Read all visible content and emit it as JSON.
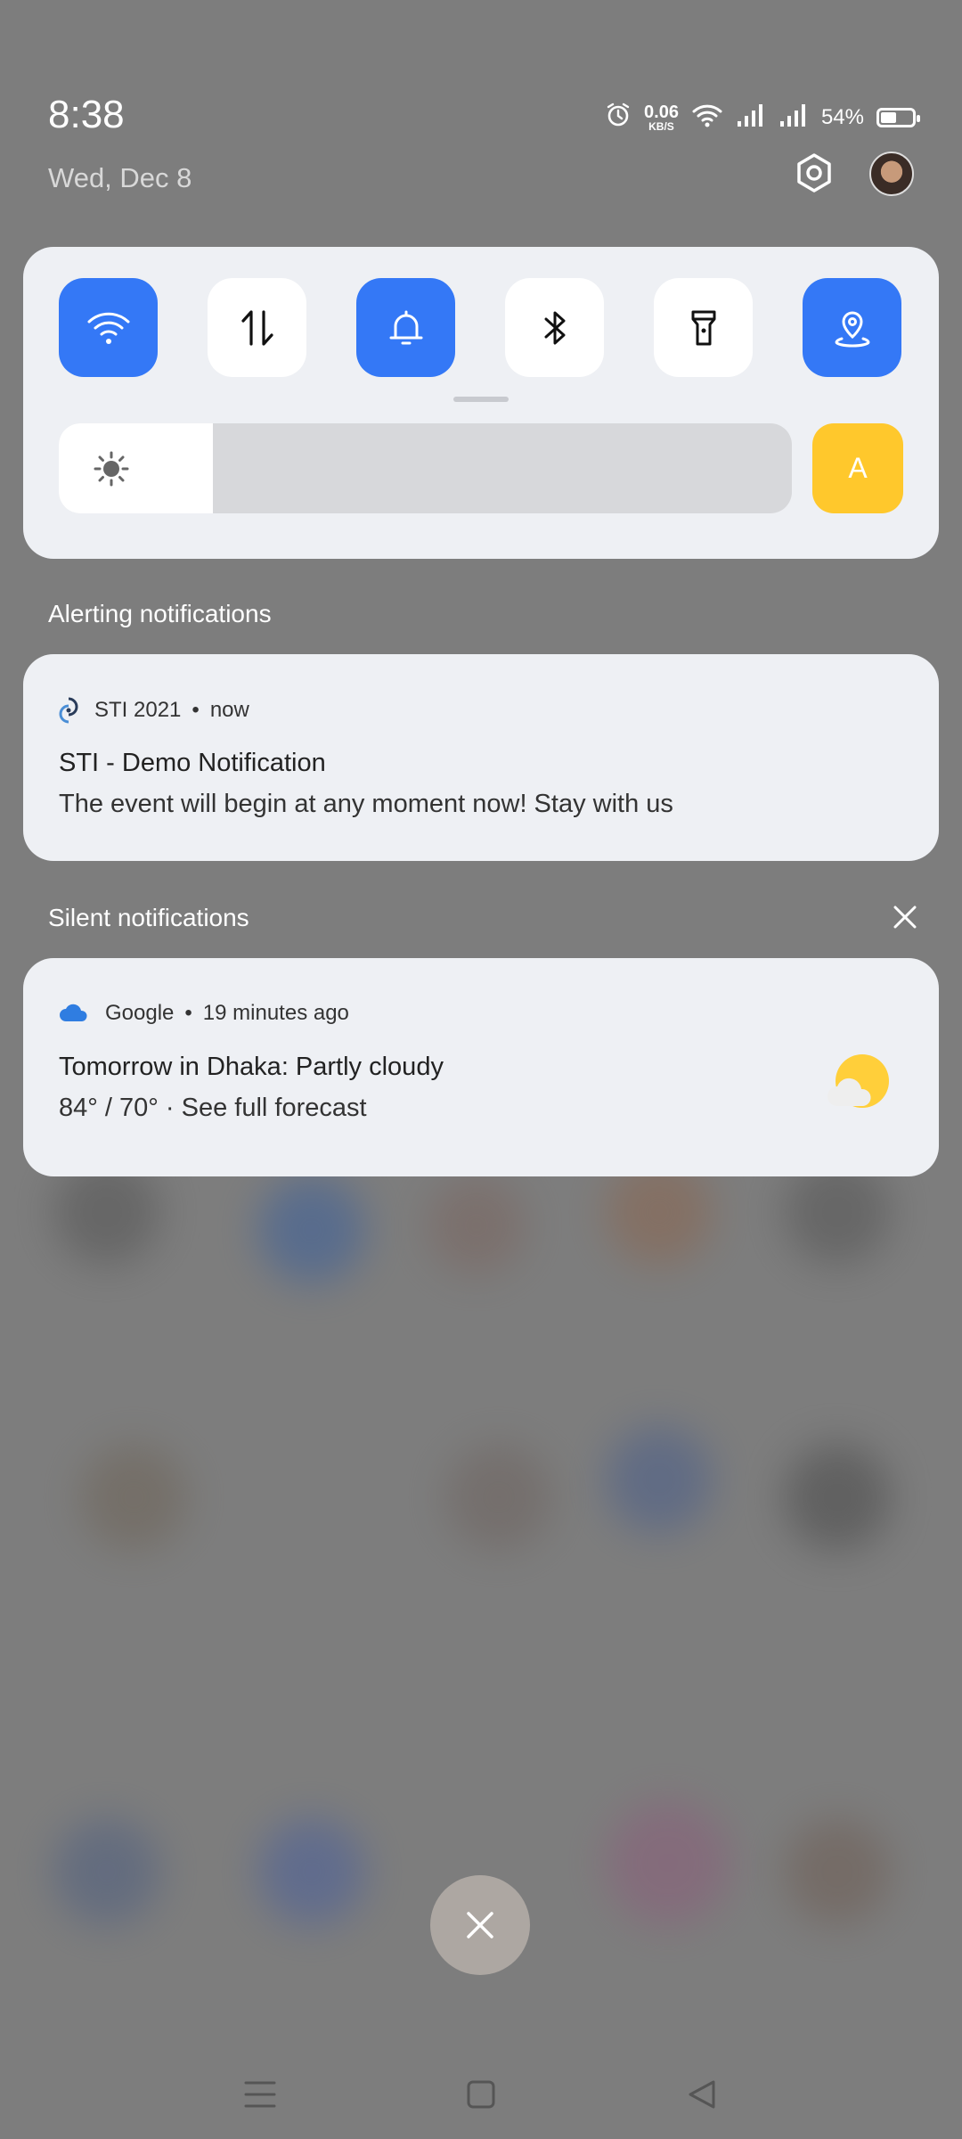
{
  "status_bar": {
    "time": "8:38",
    "date": "Wed, Dec 8",
    "net_speed_value": "0.06",
    "net_speed_unit": "KB/S",
    "battery_percent": "54%",
    "battery_level": 0.54
  },
  "quick_settings": {
    "tiles": [
      {
        "name": "wifi-icon",
        "on": true
      },
      {
        "name": "mobile-data-icon",
        "on": false
      },
      {
        "name": "bell-icon",
        "on": true
      },
      {
        "name": "bluetooth-icon",
        "on": false
      },
      {
        "name": "flashlight-icon",
        "on": false
      },
      {
        "name": "location-icon",
        "on": true
      }
    ],
    "brightness_level": 0.21,
    "auto_brightness_label": "A"
  },
  "alerting": {
    "section_title": "Alerting notifications",
    "app_name": "STI 2021",
    "time": "now",
    "title": "STI - Demo Notification",
    "body": "The event will begin at any moment now! Stay with us"
  },
  "silent": {
    "section_title": "Silent notifications",
    "app_name": "Google",
    "time": "19 minutes ago",
    "title": "Tomorrow in Dhaka: Partly cloudy",
    "body": "84° / 70° · See full forecast"
  },
  "colors": {
    "accent": "#3478f6",
    "auto_brightness": "#ffc82c",
    "panel": "#eef0f4"
  }
}
